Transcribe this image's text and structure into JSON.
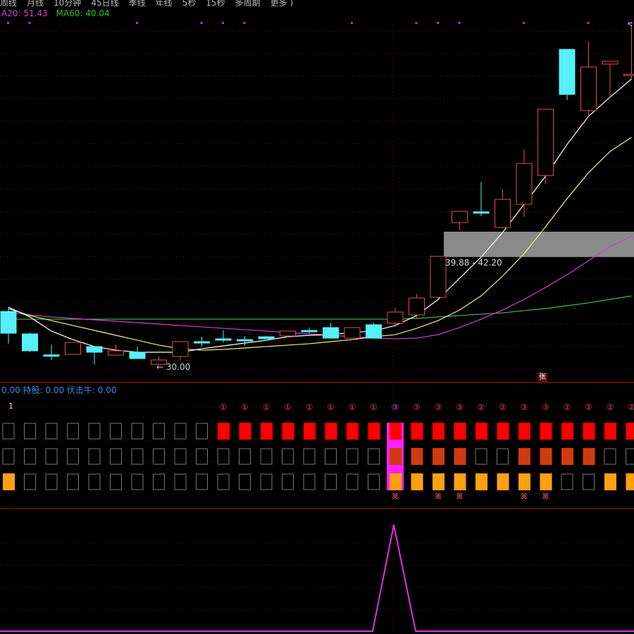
{
  "toolbar": {
    "items": [
      "周线",
      "月线",
      "10分钟",
      "45日线",
      "季线",
      "年线",
      "5秒",
      "15秒",
      "多周期",
      "更多 )"
    ]
  },
  "legend": {
    "ma20": "A20: 51.43",
    "ma60": "MA60: 40.04"
  },
  "band": {
    "low": 39.88,
    "high": 42.2,
    "label": "39.88 - 42.20"
  },
  "low_marker": "← 30.00",
  "indicator_legend": "0.00 持股: 0.00 伏击牛: 0.00",
  "row_number": "1",
  "zhang_badge": "张",
  "colors": {
    "up": "#e05050",
    "down": "#55f0f8",
    "ma5": "#ffffff",
    "ma10": "#f0f080",
    "ma20": "#d040d0",
    "ma60": "#40c040",
    "grid": "#6a1010"
  },
  "chart_data": {
    "type": "candlestick",
    "candles": [
      [
        34.9,
        35.29,
        31.94,
        32.9
      ],
      [
        32.84,
        32.95,
        31.2,
        31.29
      ],
      [
        30.92,
        31.87,
        30.45,
        30.88
      ],
      [
        30.97,
        32.06,
        30.97,
        32.06
      ],
      [
        31.68,
        31.68,
        30.05,
        31.16
      ],
      [
        30.9,
        31.87,
        30.9,
        31.29
      ],
      [
        31.16,
        31.68,
        30.58,
        30.58
      ],
      [
        30.05,
        30.77,
        30.0,
        30.45
      ],
      [
        30.77,
        32.13,
        30.39,
        32.13
      ],
      [
        32.13,
        32.58,
        31.68,
        32.1
      ],
      [
        32.39,
        33.16,
        32.06,
        32.37
      ],
      [
        32.32,
        32.65,
        31.81,
        32.3
      ],
      [
        32.58,
        32.65,
        32.39,
        32.39
      ],
      [
        32.65,
        33.1,
        32.5,
        33.1
      ],
      [
        33.16,
        33.42,
        32.9,
        33.14
      ],
      [
        33.42,
        33.87,
        32.45,
        32.45
      ],
      [
        32.45,
        33.42,
        32.45,
        33.42
      ],
      [
        33.68,
        33.87,
        32.45,
        32.45
      ],
      [
        33.81,
        35.23,
        33.48,
        34.84
      ],
      [
        34.58,
        36.52,
        34.26,
        36.13
      ],
      [
        36.19,
        39.94,
        36.06,
        39.94
      ],
      [
        43.03,
        44.06,
        42.32,
        44.06
      ],
      [
        44.02,
        46.77,
        43.61,
        43.98
      ],
      [
        42.58,
        46.06,
        42.58,
        45.16
      ],
      [
        44.71,
        49.74,
        43.55,
        48.45
      ],
      [
        47.35,
        53.42,
        46.58,
        53.42
      ],
      [
        58.9,
        58.9,
        54.26,
        54.77
      ],
      [
        53.29,
        59.61,
        52.77,
        57.29
      ],
      [
        57.55,
        57.81,
        54.45,
        57.81
      ],
      [
        56.58,
        61.16,
        56.19,
        56.62
      ]
    ],
    "ma5": [
      35.29,
      34.39,
      33.1,
      32.32,
      31.68,
      31.35,
      31.16,
      31.16,
      31.16,
      31.48,
      31.74,
      32.0,
      32.26,
      32.58,
      32.71,
      32.77,
      32.97,
      33.1,
      33.61,
      34.52,
      36.0,
      37.94,
      39.87,
      42.13,
      44.71,
      47.29,
      50.19,
      52.77,
      54.52,
      56.19
    ],
    "ma10": [
      35.16,
      34.52,
      34.06,
      33.61,
      33.16,
      32.71,
      32.26,
      31.81,
      31.48,
      31.35,
      31.42,
      31.55,
      31.68,
      31.81,
      31.94,
      32.13,
      32.32,
      32.58,
      32.77,
      33.35,
      34.06,
      35.03,
      36.32,
      38.13,
      40.19,
      42.65,
      45.23,
      47.61,
      49.55,
      50.84
    ],
    "ma20": [
      34.84,
      34.58,
      34.39,
      34.26,
      34.13,
      34.0,
      33.87,
      33.74,
      33.61,
      33.48,
      33.35,
      33.23,
      33.1,
      32.97,
      32.84,
      32.71,
      32.58,
      32.45,
      32.39,
      32.45,
      32.77,
      33.42,
      34.19,
      35.03,
      36.0,
      37.1,
      38.26,
      39.55,
      40.84,
      41.81
    ],
    "ma60": [
      34.19,
      34.19,
      34.19,
      34.19,
      34.19,
      34.19,
      34.19,
      34.19,
      34.19,
      34.19,
      34.19,
      34.19,
      34.19,
      34.19,
      34.19,
      34.19,
      34.19,
      34.19,
      34.19,
      34.26,
      34.39,
      34.52,
      34.65,
      34.77,
      34.97,
      35.16,
      35.42,
      35.68,
      36.0,
      36.32
    ],
    "top_marks": [
      0,
      1,
      6,
      9,
      10,
      11,
      16,
      19,
      20,
      21,
      24,
      27,
      29
    ],
    "circle_labels": [
      "",
      "",
      "",
      "",
      "",
      "",
      "",
      "",
      "",
      "",
      "①",
      "①",
      "①",
      "①",
      "①",
      "①",
      "①",
      "①",
      "③",
      "③",
      "③",
      "③",
      "②",
      "②",
      "③",
      "③",
      "②",
      "②",
      "②",
      "②"
    ],
    "row1": [
      0,
      0,
      0,
      0,
      0,
      0,
      0,
      0,
      0,
      0,
      1,
      1,
      1,
      1,
      1,
      1,
      1,
      1,
      1,
      1,
      1,
      1,
      1,
      1,
      1,
      1,
      1,
      1,
      1,
      1
    ],
    "row2": [
      0,
      0,
      0,
      0,
      0,
      0,
      0,
      0,
      0,
      0,
      0,
      0,
      0,
      0,
      0,
      0,
      0,
      0,
      1,
      1,
      1,
      1,
      0,
      0,
      1,
      1,
      1,
      1,
      0,
      0
    ],
    "row3": [
      1,
      0,
      0,
      0,
      0,
      0,
      0,
      0,
      0,
      0,
      0,
      0,
      0,
      0,
      0,
      0,
      0,
      0,
      1,
      1,
      1,
      1,
      1,
      1,
      1,
      1,
      0,
      0,
      1,
      1
    ],
    "butterflies": [
      18,
      20,
      21,
      24,
      25
    ],
    "highlight_col": 18,
    "signal": [
      0,
      0,
      0,
      0,
      0,
      0,
      0,
      0,
      0,
      0,
      0,
      0,
      0,
      0,
      0,
      0,
      0,
      0,
      1,
      0,
      0,
      0,
      0,
      0,
      0,
      0,
      0,
      0,
      0,
      0
    ]
  }
}
